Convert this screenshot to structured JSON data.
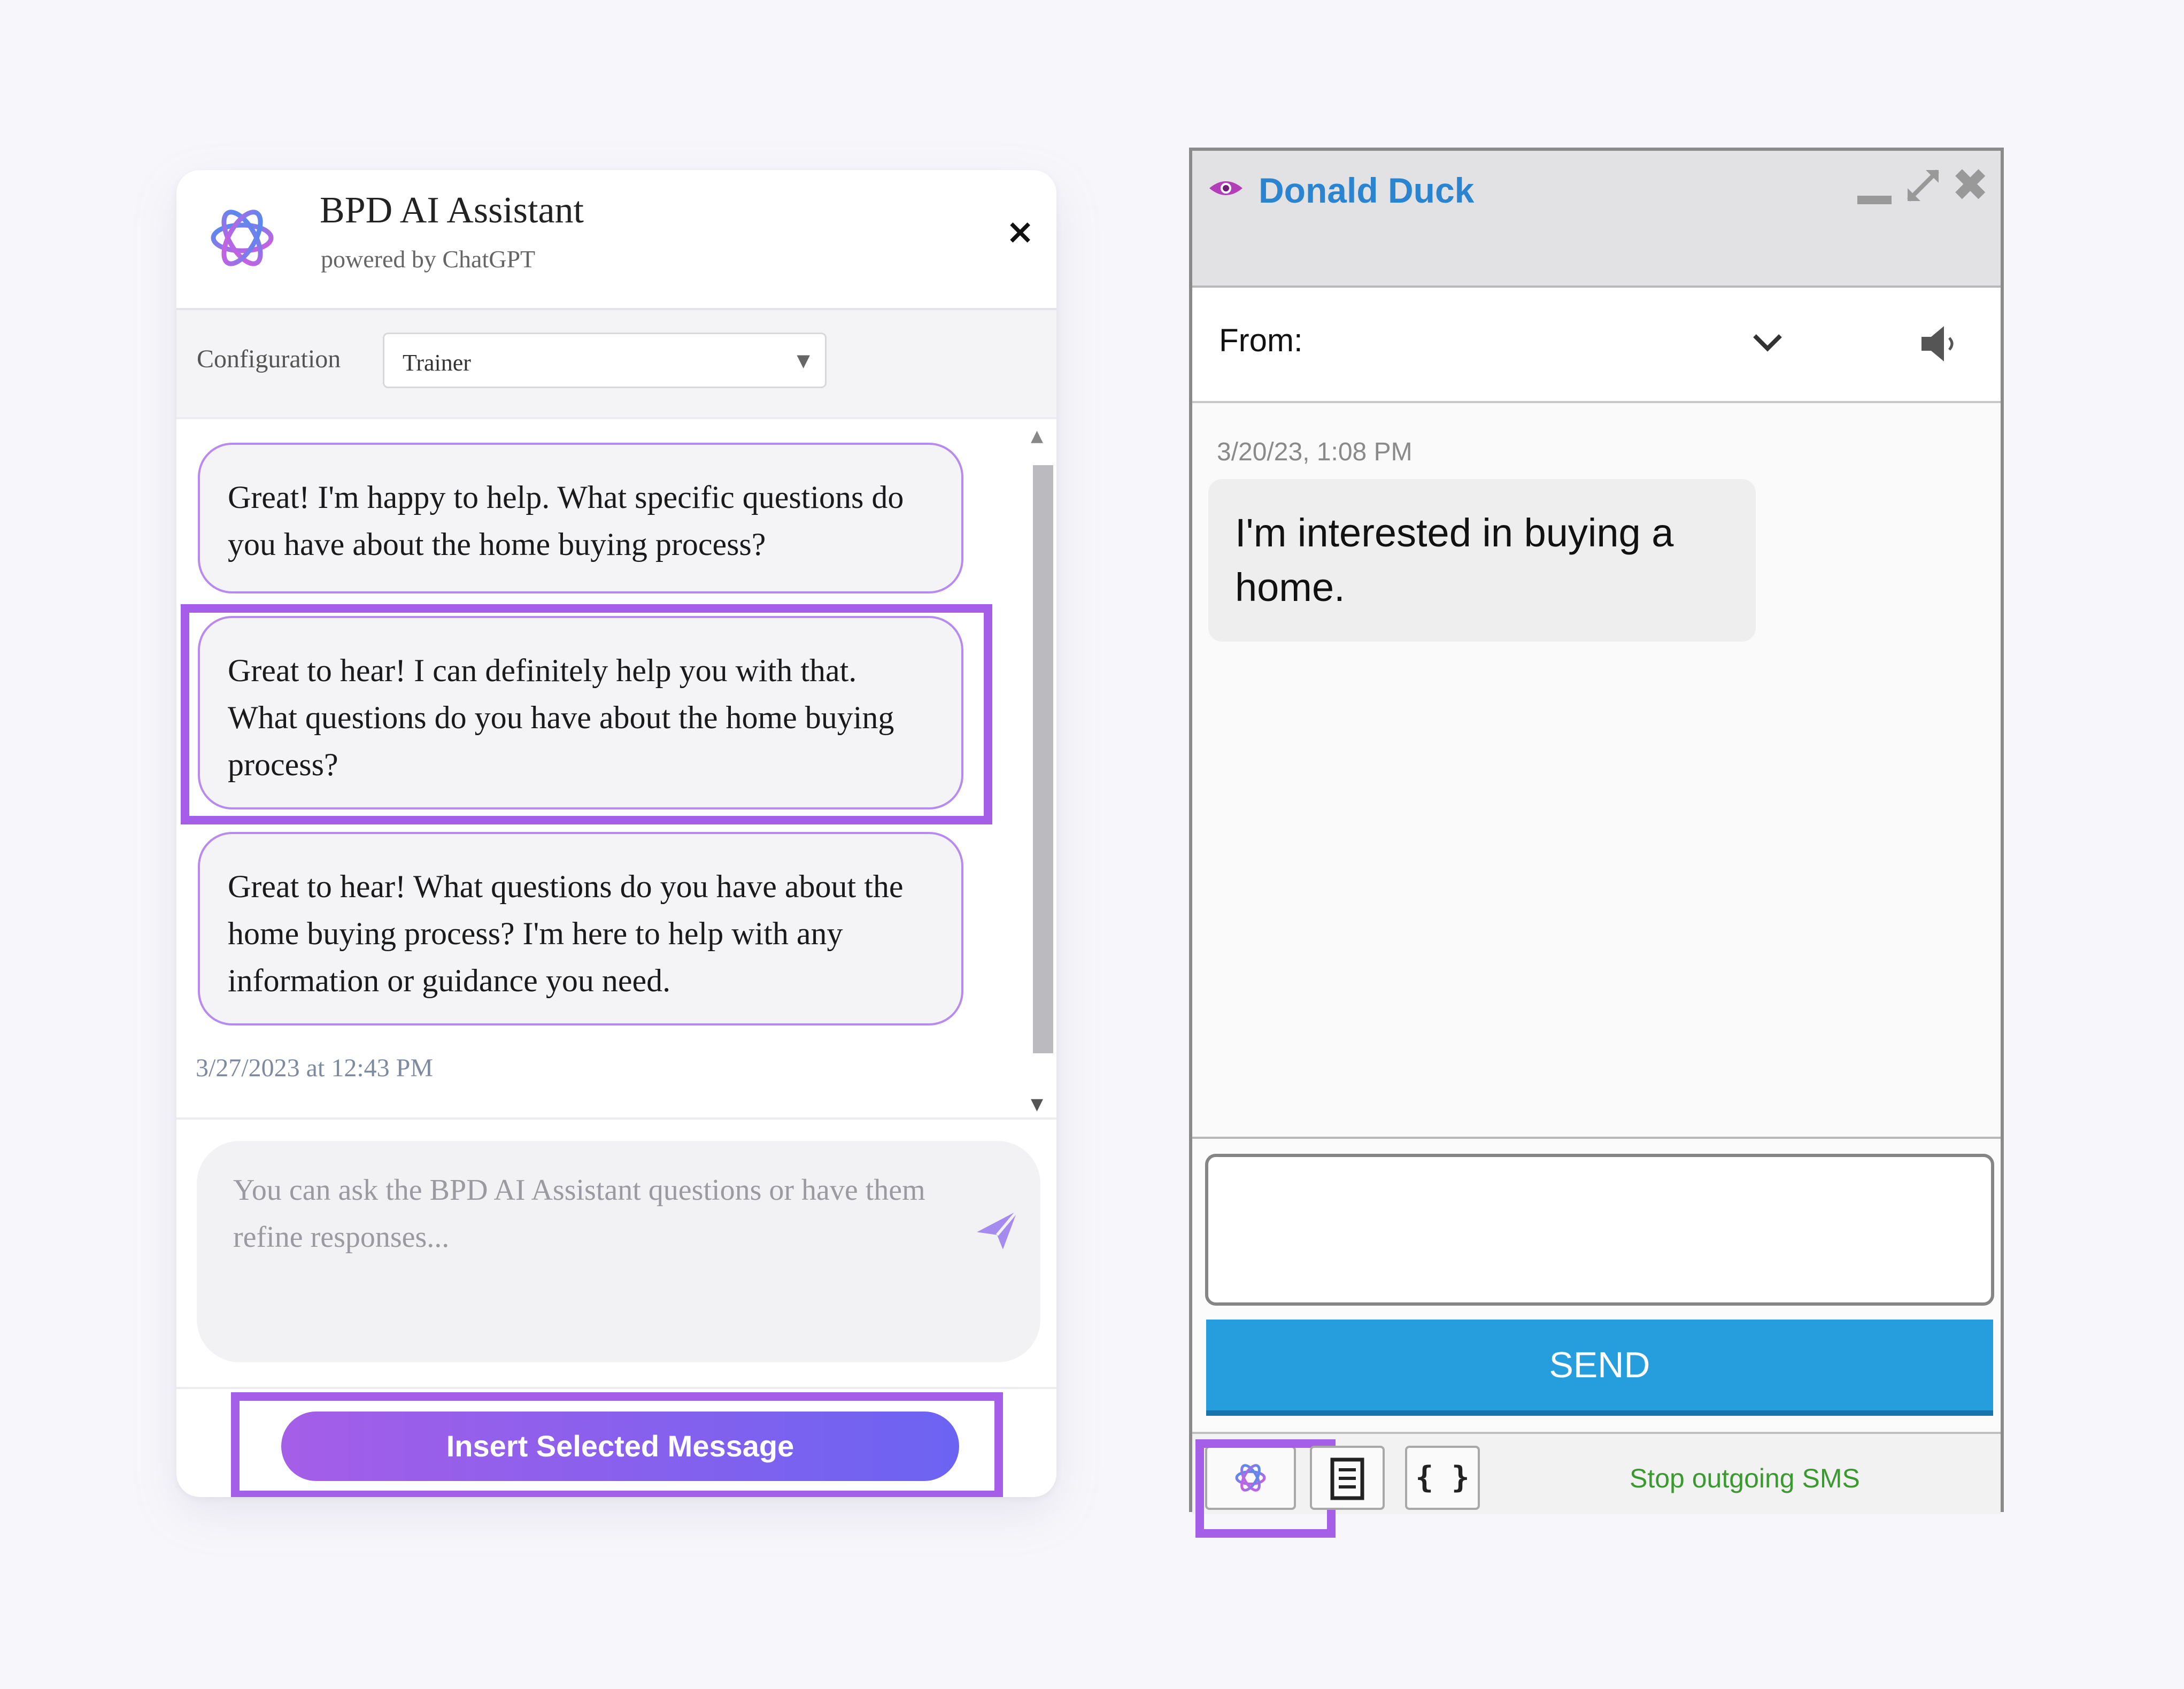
{
  "ai_panel": {
    "title": "BPD AI Assistant",
    "subtitle": "powered by ChatGPT",
    "close_label": "×",
    "config_label": "Configuration",
    "config_value": "Trainer",
    "config_arrow": "▼",
    "messages": [
      {
        "text": "Great! I'm happy to help. What specific questions do you have about the home buying process?",
        "selected": false
      },
      {
        "text": "Great to hear! I can definitely help you with that. What questions do you have about the home buying process?",
        "selected": true
      },
      {
        "text": "Great to hear! What questions do you have about the home buying process? I'm here to help with any information or guidance you need.",
        "selected": false
      }
    ],
    "timestamp": "3/27/2023 at 12:43 PM",
    "input_placeholder": "You can ask the BPD AI Assistant questions or have them refine responses...",
    "insert_button": "Insert Selected Message",
    "accent_color": "#a55ee8"
  },
  "sms_panel": {
    "contact_name": "Donald Duck",
    "from_label": "From:",
    "message_time": "3/20/23, 1:08 PM",
    "incoming_message": "I'm interested in buying a home.",
    "send_label": "SEND",
    "code_button_label": "{ }",
    "stop_label": "Stop outgoing SMS",
    "send_color": "#269ddc",
    "icons": [
      "eye-icon",
      "minimize-icon",
      "expand-icon",
      "close-icon",
      "chevron-down-icon",
      "speaker-icon",
      "openai-icon",
      "document-icon",
      "code-braces-icon"
    ]
  }
}
